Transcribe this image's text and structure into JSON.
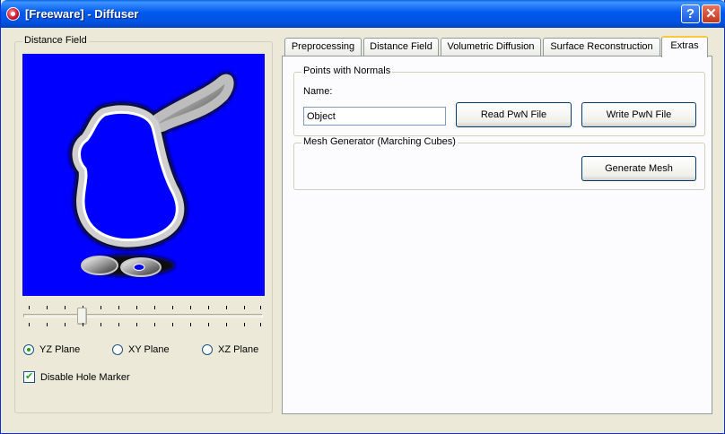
{
  "window": {
    "title": "[Freeware] - Diffuser",
    "help_label": "?",
    "close_label": "✕"
  },
  "distance_field_panel": {
    "group_label": "Distance Field",
    "slider": {
      "value": 0.24,
      "tick_count": 14
    },
    "planes": [
      {
        "label": "YZ Plane",
        "selected": true
      },
      {
        "label": "XY Plane",
        "selected": false
      },
      {
        "label": "XZ Plane",
        "selected": false
      }
    ],
    "disable_hole_marker": {
      "label": "Disable Hole Marker",
      "checked": true
    }
  },
  "tabs": [
    {
      "label": "Preprocessing",
      "active": false
    },
    {
      "label": "Distance Field",
      "active": false
    },
    {
      "label": "Volumetric Diffusion",
      "active": false
    },
    {
      "label": "Surface Reconstruction",
      "active": false
    },
    {
      "label": "Extras",
      "active": true
    }
  ],
  "extras": {
    "points_group_label": "Points with Normals",
    "name_label": "Name:",
    "name_value": "Object",
    "read_button": "Read PwN File",
    "write_button": "Write PwN File",
    "mesh_group_label": "Mesh Generator (Marching Cubes)",
    "generate_button": "Generate Mesh"
  },
  "colors": {
    "field_background": "#0000FF",
    "titlebar": "#0054E3",
    "window_face": "#ECE9D8"
  }
}
